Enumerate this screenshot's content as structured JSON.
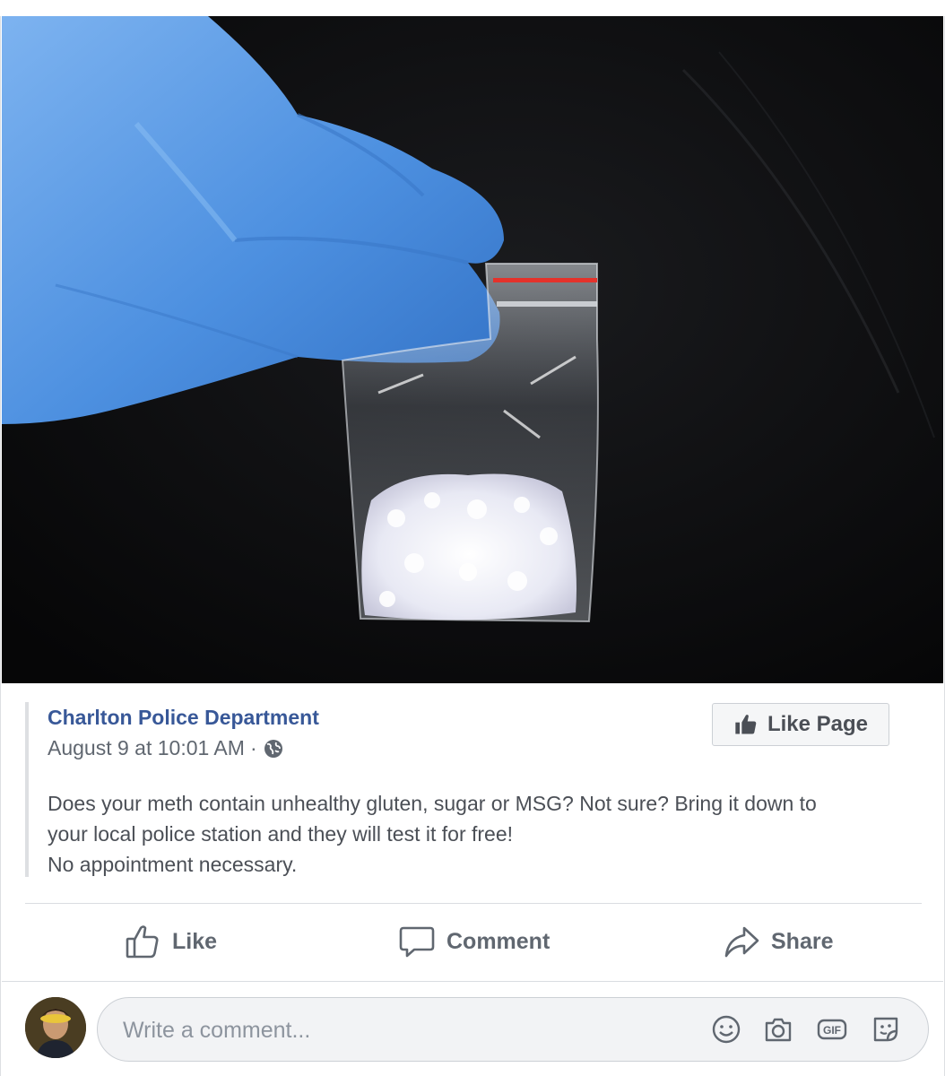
{
  "post": {
    "page_name": "Charlton Police Department",
    "timestamp": "August 9 at 10:01 AM",
    "separator": "·",
    "audience_icon": "globe-icon",
    "text_lines": [
      "Does your meth contain unhealthy gluten, sugar or MSG? Not sure? Bring it down to",
      "your local police station and they will test it for free!",
      "No appointment necessary."
    ]
  },
  "like_page_button": {
    "label": "Like Page",
    "icon": "thumbs-up-icon"
  },
  "actions": {
    "like": {
      "label": "Like",
      "icon": "like-outline-icon"
    },
    "comment": {
      "label": "Comment",
      "icon": "comment-icon"
    },
    "share": {
      "label": "Share",
      "icon": "share-icon"
    }
  },
  "comment_box": {
    "placeholder": "Write a comment...",
    "icons": [
      "emoji-icon",
      "camera-icon",
      "gif-icon",
      "sticker-icon"
    ],
    "gif_label": "GIF"
  },
  "colors": {
    "link": "#385898",
    "text": "#4b4f56",
    "muted": "#606770",
    "glove": "#5a9be6",
    "background_photo": "#0b0b0d"
  }
}
